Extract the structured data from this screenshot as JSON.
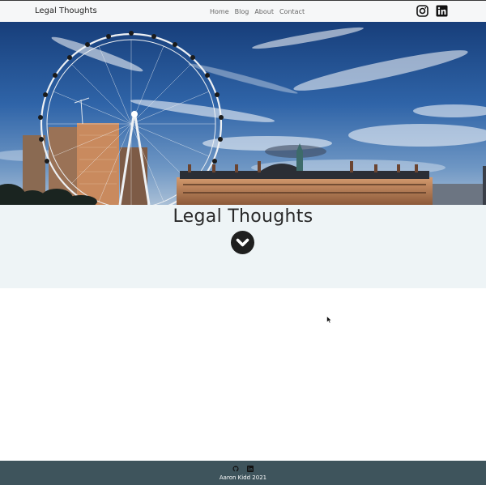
{
  "navbar": {
    "brand": "Legal Thoughts",
    "links": [
      "Home",
      "Blog",
      "About",
      "Contact"
    ],
    "social": [
      "instagram-icon",
      "linkedin-icon"
    ]
  },
  "hero": {
    "image_subject": "London Eye and County Hall under blue sky"
  },
  "main": {
    "title": "Legal Thoughts",
    "scroll_icon": "chevron-down-icon"
  },
  "footer": {
    "icons": [
      "github-icon",
      "linkedin-icon"
    ],
    "text": "Aaron Kidd 2021"
  },
  "colors": {
    "navbar_bg": "#f6f7f8",
    "band_bg": "#eef4f6",
    "footer_bg": "#3e545c",
    "sky": "#2d5fa3"
  }
}
